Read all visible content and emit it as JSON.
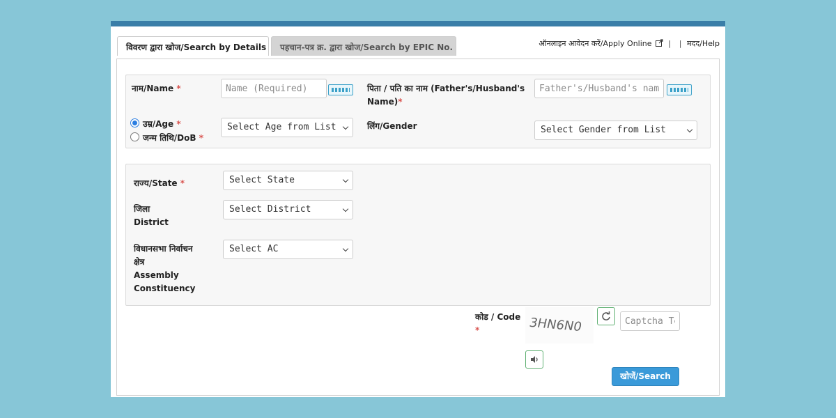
{
  "tabs": {
    "details": "विवरण द्वारा खोज/Search by Details",
    "epic": "पहचान-पत्र क्र. द्वारा खोज/Search by EPIC No."
  },
  "toplinks": {
    "apply_online": "ऑनलाइन आवेदन करें/Apply Online",
    "external_icon": "external-link-icon",
    "sep": "|",
    "help": "मदद/Help"
  },
  "form": {
    "name_label": "नाम/Name",
    "name_placeholder": "Name (Required)",
    "father_label_line1": "पिता / पति का नाम (Father's/Husband's",
    "father_label_line2": "Name)",
    "father_placeholder": "Father's/Husband's name",
    "age_label": "उम्र/Age",
    "dob_label": "जन्म तिथि/DoB",
    "age_select": "Select Age from List",
    "gender_label": "लिंग/Gender",
    "gender_select": "Select Gender from List",
    "state_label": "राज्य/State",
    "state_select": "Select State",
    "district_label_line1": "जिला",
    "district_label_line2": "District",
    "district_select": "Select District",
    "ac_label_line1": "विधानसभा निर्वाचन",
    "ac_label_line2": "क्षेत्र",
    "ac_label_line3": "Assembly",
    "ac_label_line4": "Constituency",
    "ac_select": "Select AC",
    "code_label": "कोड / Code",
    "captcha_text": "3HN6N0",
    "captcha_placeholder": "Captcha Text",
    "required_mark": "*",
    "search_button": "खोजें/Search"
  },
  "selected_option": "age",
  "icons": [
    "keyboard-icon",
    "refresh-icon",
    "speaker-icon",
    "external-link-icon"
  ],
  "colors": {
    "background": "#87c6d7",
    "header_bar": "#3a7ea8",
    "required": "#d9534f",
    "button": "#3a9ad9",
    "radio": "#2a7de1"
  }
}
